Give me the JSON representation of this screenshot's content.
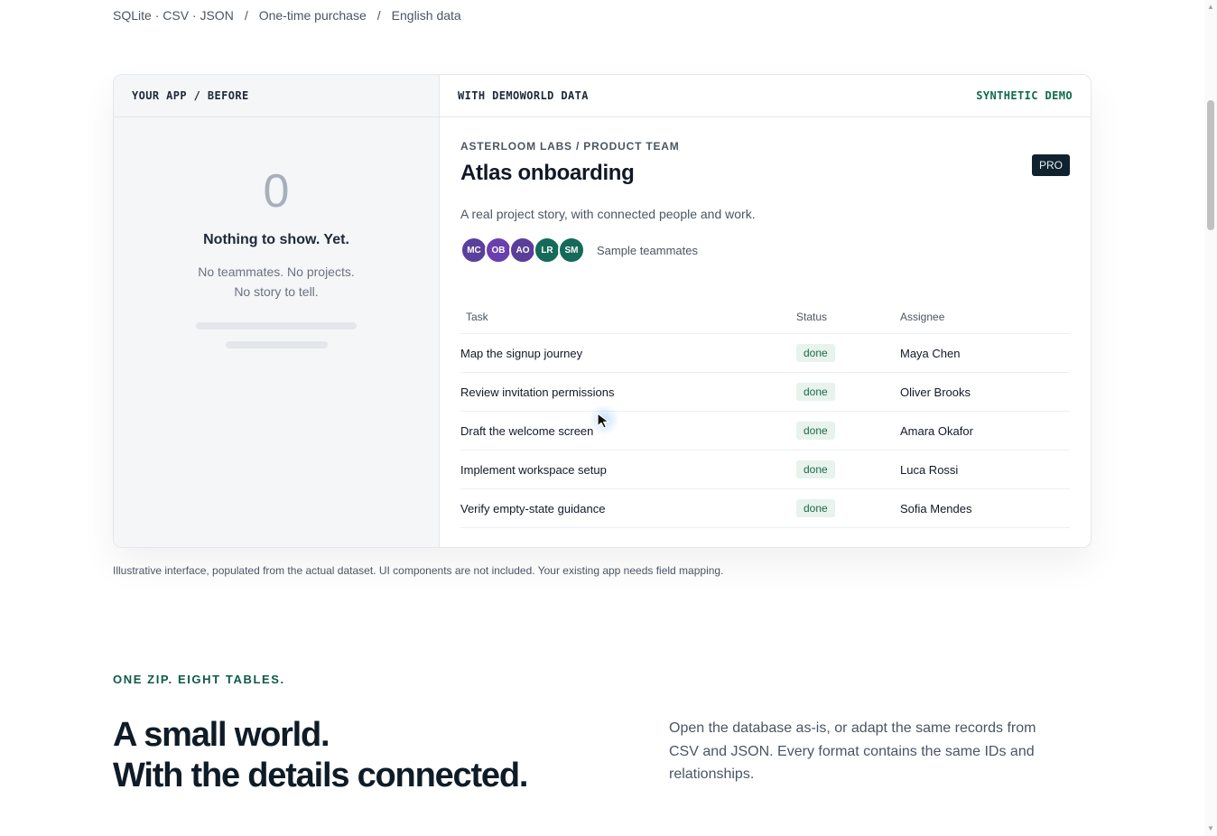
{
  "meta": {
    "formats": "SQLite · CSV · JSON",
    "separator": "/",
    "purchase": "One-time purchase",
    "language": "English data"
  },
  "compare": {
    "before_header": "YOUR APP / BEFORE",
    "after_header": "WITH DEMOWORLD DATA",
    "after_tag": "SYNTHETIC DEMO",
    "empty": {
      "count": "0",
      "title": "Nothing to show. Yet.",
      "line1": "No teammates. No projects.",
      "line2": "No story to tell."
    },
    "project": {
      "org": "ASTERLOOM LABS / PRODUCT TEAM",
      "title": "Atlas onboarding",
      "badge": "PRO",
      "description": "A real project story, with connected people and work.",
      "team_label": "Sample teammates",
      "avatars": [
        {
          "initials": "MC",
          "color": "#5b3f9c"
        },
        {
          "initials": "OB",
          "color": "#6a3fae"
        },
        {
          "initials": "AO",
          "color": "#5a3e99"
        },
        {
          "initials": "LR",
          "color": "#146b5a"
        },
        {
          "initials": "SM",
          "color": "#156a59"
        }
      ]
    },
    "table": {
      "headers": {
        "task": "Task",
        "status": "Status",
        "assignee": "Assignee"
      },
      "rows": [
        {
          "task": "Map the signup journey",
          "status": "done",
          "assignee": "Maya Chen"
        },
        {
          "task": "Review invitation permissions",
          "status": "done",
          "assignee": "Oliver Brooks"
        },
        {
          "task": "Draft the welcome screen",
          "status": "done",
          "assignee": "Amara Okafor"
        },
        {
          "task": "Implement workspace setup",
          "status": "done",
          "assignee": "Luca Rossi"
        },
        {
          "task": "Verify empty-state guidance",
          "status": "done",
          "assignee": "Sofia Mendes"
        }
      ]
    }
  },
  "caption": "Illustrative interface, populated from the actual dataset. UI components are not included. Your existing app needs field mapping.",
  "section": {
    "eyebrow": "ONE ZIP. EIGHT TABLES.",
    "headline_line1": "A small world.",
    "headline_line2": "With the details connected.",
    "lede": "Open the database as-is, or adapt the same records from CSV and JSON. Every format contains the same IDs and relationships."
  },
  "icons": {
    "cursor": "mouse-pointer-icon",
    "scroll_up": "scroll-up-arrow-icon",
    "scroll_down": "scroll-down-arrow-icon"
  }
}
